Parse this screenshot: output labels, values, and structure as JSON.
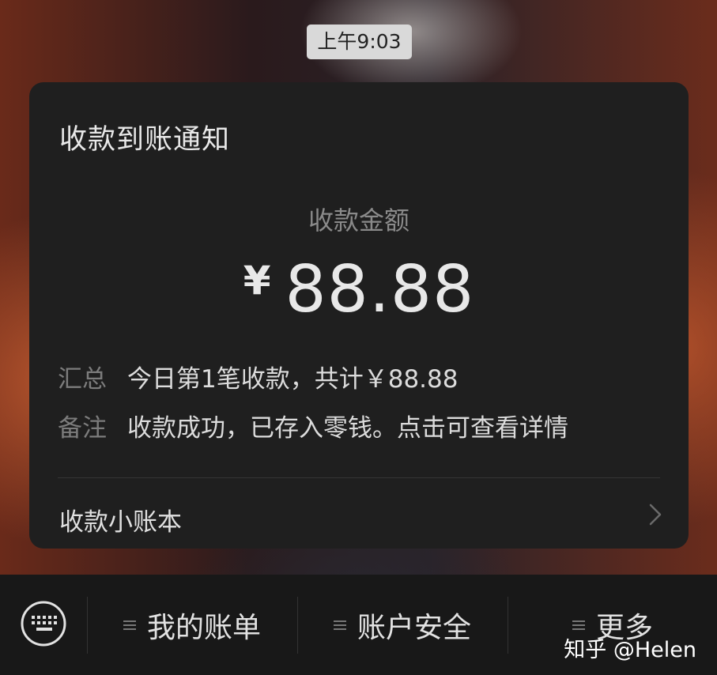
{
  "status": {
    "time": "上午9:03"
  },
  "notification": {
    "title": "收款到账通知",
    "amount_label": "收款金额",
    "currency_symbol": "¥",
    "amount": "88.88",
    "rows": [
      {
        "key": "汇总",
        "value": "今日第1笔收款，共计￥88.88"
      },
      {
        "key": "备注",
        "value": "收款成功，已存入零钱。点击可查看详情"
      }
    ],
    "link_label": "收款小账本",
    "link_icon": "chevron-right-icon"
  },
  "menu": {
    "keyboard_icon": "keyboard-icon",
    "items": [
      {
        "label": "我的账单",
        "icon": "menu-lines-icon"
      },
      {
        "label": "账户安全",
        "icon": "menu-lines-icon"
      },
      {
        "label": "更多",
        "icon": "menu-lines-icon"
      }
    ]
  },
  "watermark": "知乎 @Helen",
  "colors": {
    "card_bg": "#1f1f1f",
    "menu_bg": "#181818",
    "time_pill_bg": "#d9d9d9",
    "muted_text": "#8a8a8a"
  }
}
